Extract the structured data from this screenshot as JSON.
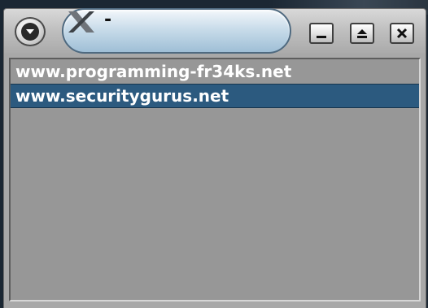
{
  "window": {
    "title": "-",
    "controls": {
      "menu_icon": "chevron-down-icon",
      "minimize_icon": "minimize-icon",
      "shade_icon": "eject-icon",
      "close_icon": "close-icon"
    }
  },
  "list": {
    "items": [
      {
        "label": "www.programming-fr34ks.net",
        "selected": false
      },
      {
        "label": "www.securitygurus.net",
        "selected": true
      }
    ]
  },
  "colors": {
    "selection": "#2c5a7f",
    "list_background": "#979797",
    "title_pill": "#c9dcea"
  }
}
